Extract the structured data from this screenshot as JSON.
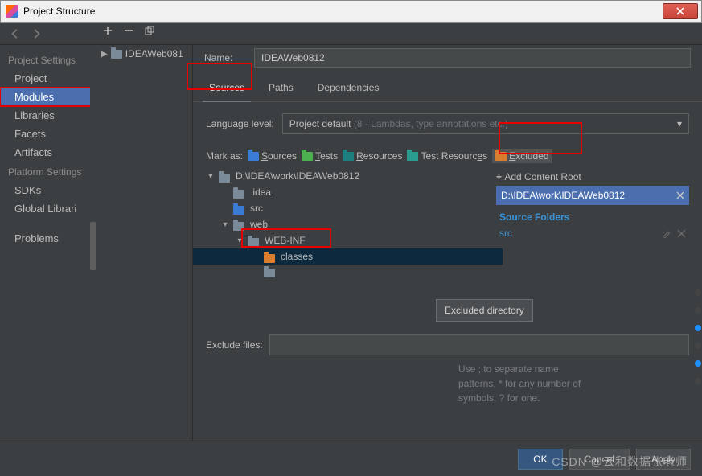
{
  "window": {
    "title": "Project Structure"
  },
  "sidebar": {
    "groups": [
      {
        "heading": "Project Settings",
        "items": [
          "Project",
          "Modules",
          "Libraries",
          "Facets",
          "Artifacts"
        ],
        "selected": 1,
        "highlight": 1
      },
      {
        "heading": "Platform Settings",
        "items": [
          "SDKs",
          "Global Librari"
        ]
      },
      {
        "heading": "",
        "items": [
          "Problems"
        ]
      }
    ]
  },
  "module_tree": {
    "root": "IDEAWeb081"
  },
  "name": {
    "label": "Name:",
    "value": "IDEAWeb0812"
  },
  "tabs": {
    "items": [
      "Sources",
      "Paths",
      "Dependencies"
    ],
    "active": 0
  },
  "language_level": {
    "label": "Language level:",
    "value": "Project default",
    "hint": "(8 - Lambdas, type annotations etc.)"
  },
  "mark_as": {
    "label": "Mark as:",
    "buttons": [
      {
        "label": "Sources",
        "u": "S",
        "color": "m-blue"
      },
      {
        "label": "Tests",
        "u": "T",
        "color": "m-green"
      },
      {
        "label": "Resources",
        "u": "R",
        "color": "m-teal"
      },
      {
        "label": "Test Resources",
        "u": "",
        "color": "m-teal2"
      },
      {
        "label": "Excluded",
        "u": "E",
        "color": "m-orange"
      }
    ]
  },
  "tree": {
    "root": "D:\\IDEA\\work\\IDEAWeb0812",
    "nodes": [
      {
        "level": 1,
        "label": ".idea",
        "color": "m-gray"
      },
      {
        "level": 1,
        "label": "src",
        "color": "m-blue"
      },
      {
        "level": 1,
        "label": "web",
        "color": "m-gray",
        "expandable": true,
        "open": true
      },
      {
        "level": 2,
        "label": "WEB-INF",
        "color": "m-gray",
        "expandable": true,
        "open": true
      },
      {
        "level": 3,
        "label": "classes",
        "color": "m-orange",
        "selected": true
      }
    ]
  },
  "tooltip": "Excluded directory",
  "rightpanel": {
    "add_root": "Add Content Root",
    "root": "D:\\IDEA\\work\\IDEAWeb0812",
    "sf_head": "Source Folders",
    "sf_items": [
      "src"
    ]
  },
  "exclude": {
    "label": "Exclude files:",
    "hint": "Use ; to separate name patterns, * for any number of symbols, ? for one."
  },
  "buttons": {
    "ok": "OK",
    "cancel": "Cancel",
    "apply": "Apply"
  },
  "watermark": "CSDN @云和数据张老师"
}
